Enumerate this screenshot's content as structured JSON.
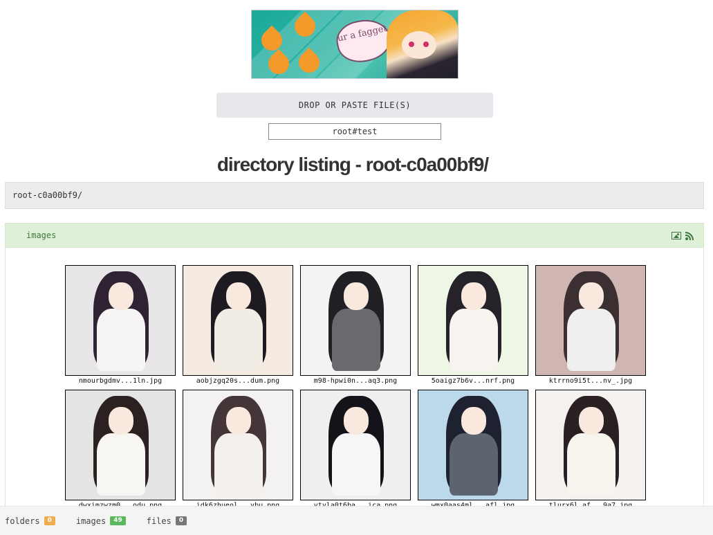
{
  "banner": {
    "text": "ur a fagget"
  },
  "upload": {
    "drop_label": "DROP OR PASTE FILE(S)",
    "path_value": "root#test"
  },
  "page": {
    "title": "directory listing - root-c0a00bf9/"
  },
  "breadcrumb": {
    "path": "root-c0a00bf9/"
  },
  "panel": {
    "title": "images"
  },
  "images": [
    {
      "name": "nmourbgdmv...1ln.jpg",
      "bg": "#e9e6ea",
      "hair": "#2e2233",
      "dress": "#f6f5f3"
    },
    {
      "name": "aobjzgq20s...dum.png",
      "bg": "#f6ebe0",
      "hair": "#1d1a22",
      "dress": "#f2ede4"
    },
    {
      "name": "m98-hpwi0n...aq3.png",
      "bg": "#f3f3f3",
      "hair": "#1f1f24",
      "dress": "#6a6a6e"
    },
    {
      "name": "5oaigz7b6v...nrf.png",
      "bg": "#eef6e6",
      "hair": "#262229",
      "dress": "#f7f4ef"
    },
    {
      "name": "ktrrno9i5t...nv_.jpg",
      "bg": "#cfb6b3",
      "hair": "#3b2f31",
      "dress": "#f0efef"
    },
    {
      "name": "dwximzwzm0...odu.png",
      "bg": "#e4e4e4",
      "hair": "#2a2120",
      "dress": "#f8f6f3"
    },
    {
      "name": "idk6zhueol...ybu.png",
      "bg": "#f4f1f1",
      "hair": "#433538",
      "dress": "#f3f0ed"
    },
    {
      "name": "vtvla0t6ba...ica.png",
      "bg": "#efefef",
      "hair": "#15131a",
      "dress": "#f6f6f6"
    },
    {
      "name": "wmx0aas4ml...afl.jpg",
      "bg": "#bcd9ec",
      "hair": "#1e2230",
      "dress": "#5c6470"
    },
    {
      "name": "tlurx6l_af...9a7.jpg",
      "bg": "#f5f1ee",
      "hair": "#2a1f22",
      "dress": "#f7f4ee"
    }
  ],
  "footer": {
    "folders_label": "folders",
    "folders_count": "0",
    "folders_color": "#f0ad4e",
    "images_label": "images",
    "images_count": "49",
    "images_color": "#5cb85c",
    "files_label": "files",
    "files_count": "0",
    "files_color": "#777777"
  }
}
